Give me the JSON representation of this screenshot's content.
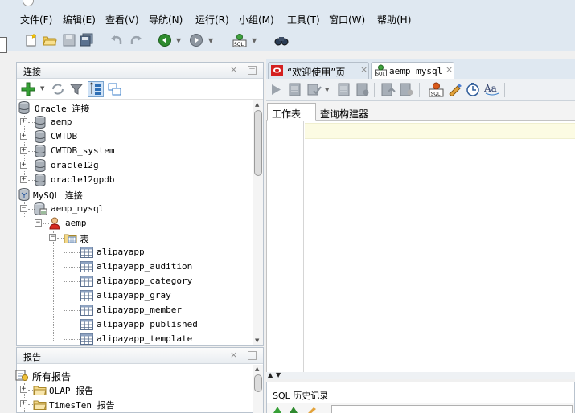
{
  "menubar": {
    "items": [
      "文件(F)",
      "编辑(E)",
      "查看(V)",
      "导航(N)",
      "运行(R)",
      "小组(M)",
      "工具(T)",
      "窗口(W)",
      "帮助(H)"
    ]
  },
  "toolbar": {
    "icons": [
      "new-icon",
      "open-icon",
      "save-icon",
      "save-all-icon",
      "undo-icon",
      "redo-icon",
      "back-icon",
      "forward-icon",
      "sql-worksheet-icon",
      "find-db-object-icon"
    ]
  },
  "connections_panel": {
    "title": "连接",
    "close_glyph": "×",
    "minimize_glyph": "－",
    "tree": {
      "oracle_group": "Oracle 连接",
      "oracle_items": [
        "aemp",
        "CWTDB",
        "CWTDB_system",
        "oracle12g",
        "oracle12gpdb"
      ],
      "mysql_group": "MySQL 连接",
      "mysql_connection": "aemp_mysql",
      "schema": "aemp",
      "tables_folder": "表",
      "tables": [
        "alipayapp",
        "alipayapp_audition",
        "alipayapp_category",
        "alipayapp_gray",
        "alipayapp_member",
        "alipayapp_published",
        "alipayapp_template"
      ]
    }
  },
  "reports_panel": {
    "title": "报告",
    "close_glyph": "×",
    "minimize_glyph": "－",
    "tree": {
      "all_reports": "所有报告",
      "items": [
        "OLAP 报告",
        "TimesTen 报告"
      ]
    }
  },
  "editor": {
    "tabs": [
      {
        "label": "“欢迎使用”页",
        "close": "×"
      },
      {
        "label": "aemp_mysql",
        "close": "×"
      }
    ],
    "subtabs": [
      "工作表",
      "查询构建器"
    ]
  },
  "history_panel": {
    "title": "SQL 历史记录"
  },
  "colors": {
    "chrome_bg": "#dfe8f1",
    "current_line": "#fcfbe3",
    "oracle_red": "#d42020",
    "green_plus": "#2f9a2f"
  }
}
